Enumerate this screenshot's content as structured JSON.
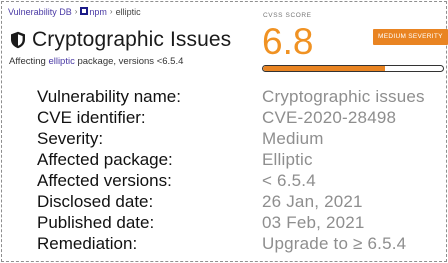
{
  "breadcrumb": {
    "root": "Vulnerability DB",
    "separator": "›",
    "ecosystem": "npm",
    "package": "elliptic"
  },
  "header": {
    "title": "Cryptographic Issues",
    "affecting_prefix": "Affecting",
    "affecting_package": "elliptic",
    "affecting_suffix": "package, versions <6.5.4"
  },
  "score": {
    "label": "CVSS SCORE",
    "value": "6.8",
    "severity_badge": "MEDIUM SEVERITY",
    "bar_fraction": 0.68,
    "accent_color": "#e98422"
  },
  "details": [
    {
      "label": "Vulnerability name:",
      "value": "Cryptographic issues"
    },
    {
      "label": "CVE identifier:",
      "value": "CVE-2020-28498"
    },
    {
      "label": "Severity:",
      "value": "Medium"
    },
    {
      "label": "Affected package:",
      "value": "Elliptic"
    },
    {
      "label": "Affected versions:",
      "value": "< 6.5.4"
    },
    {
      "label": "Disclosed date:",
      "value": "26 Jan, 2021"
    },
    {
      "label": "Published date:",
      "value": "03 Feb, 2021"
    },
    {
      "label": "Remediation:",
      "value": "Upgrade to ≥ 6.5.4"
    }
  ],
  "icons": {
    "title_icon": "shield-icon",
    "ecosystem_icon": "npm-icon"
  }
}
